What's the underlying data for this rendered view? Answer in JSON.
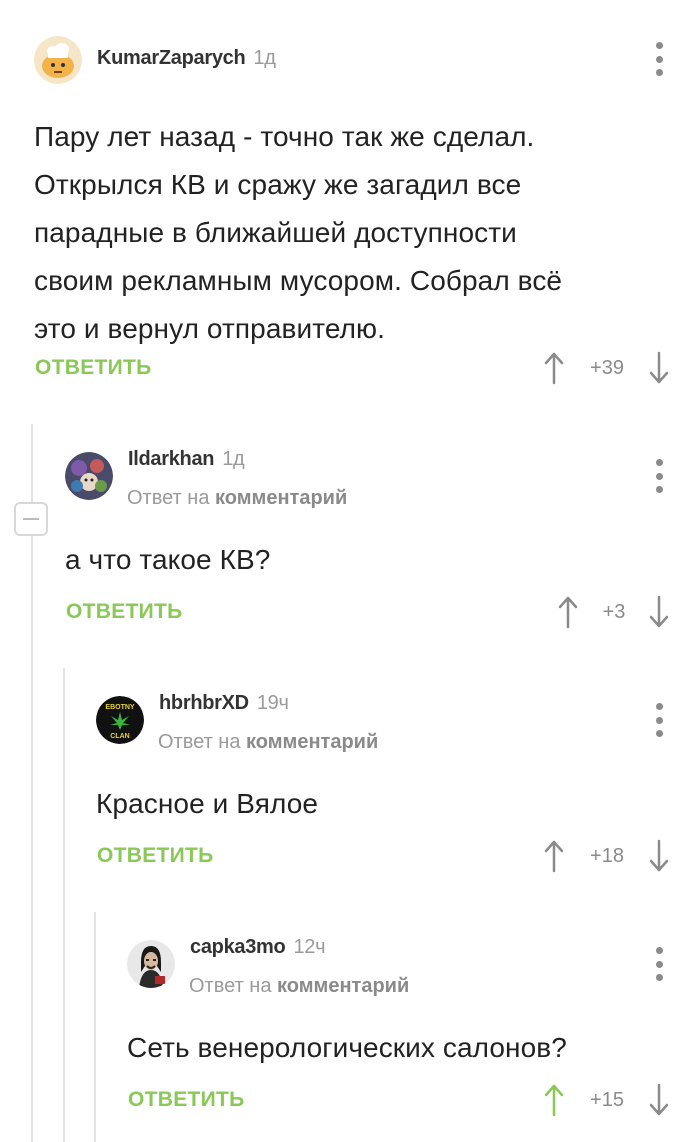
{
  "comments": [
    {
      "username": "KumarZaparych",
      "time": "1д",
      "text_lines": [
        "Пару лет назад - точно так же сделал.",
        "Открылся КВ и сражу же загадил все",
        "парадные в ближайшей доступности",
        "своим рекламным мусором. Собрал всё",
        "это и вернул отправителю."
      ],
      "reply_label": "ОТВЕТИТЬ",
      "score": "+39"
    },
    {
      "username": "Ildarkhan",
      "time": "1д",
      "reply_to_prefix": "Ответ на",
      "reply_to_link": "комментарий",
      "text": "а что такое КВ?",
      "reply_label": "ОТВЕТИТЬ",
      "score": "+3"
    },
    {
      "username": "hbrhbrXD",
      "time": "19ч",
      "avatar_text_top": "EBOTNY",
      "avatar_text_bottom": "CLAN",
      "reply_to_prefix": "Ответ на",
      "reply_to_link": "комментарий",
      "text": "Красное и Вялое",
      "reply_label": "ОТВЕТИТЬ",
      "score": "+18"
    },
    {
      "username": "capka3mo",
      "time": "12ч",
      "reply_to_prefix": "Ответ на",
      "reply_to_link": "комментарий",
      "text": "Сеть венерологических салонов?",
      "reply_label": "ОТВЕТИТЬ",
      "score": "+15"
    }
  ],
  "colors": {
    "accent_green": "#8ac858",
    "upvoted_arrow": "#8ac858",
    "muted_gray": "#8a8a8a",
    "thread_line": "#e4e4e4"
  },
  "icons": {
    "more": "more-vertical-icon",
    "upvote": "arrow-up-icon",
    "downvote": "arrow-down-icon",
    "collapse": "minus-icon"
  }
}
